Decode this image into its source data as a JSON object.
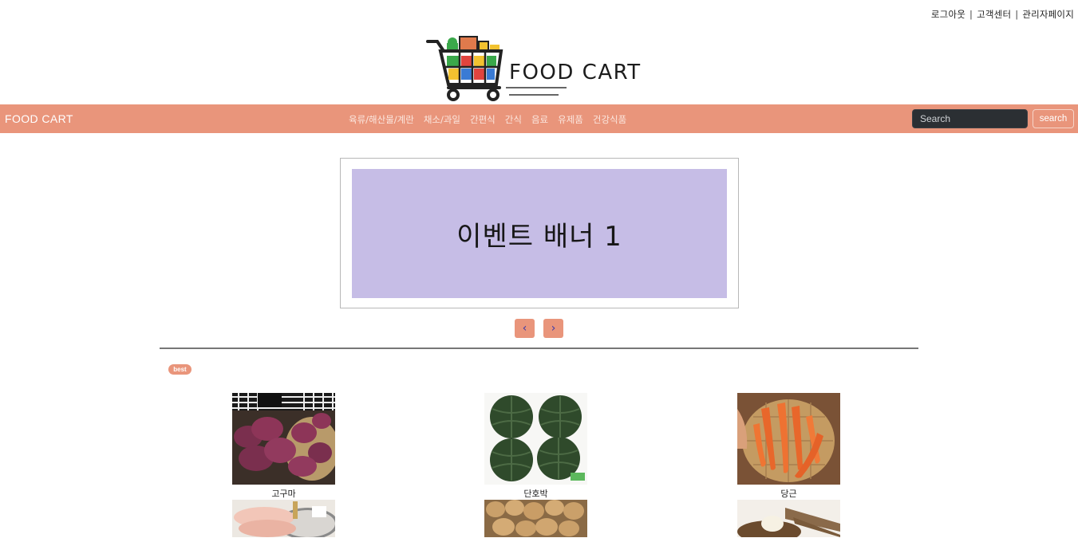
{
  "header": {
    "links": [
      {
        "label": "로그아웃"
      },
      {
        "label": "고객센터"
      },
      {
        "label": "관리자페이지"
      }
    ],
    "separator": "|",
    "logo_text": "FOOD CART"
  },
  "navbar": {
    "brand": "FOOD CART",
    "menu": [
      "육류/해산물/계란",
      "채소/과일",
      "간편식",
      "간식",
      "음료",
      "유제품",
      "건강식품"
    ],
    "search_placeholder": "Search",
    "search_button": "search",
    "background": "#e9957b"
  },
  "banner": {
    "text": "이벤트 배너 1",
    "background": "#c6bde6",
    "prev_label": "‹",
    "next_label": "›"
  },
  "section": {
    "badge": "best"
  },
  "products": [
    {
      "name": "고구마",
      "image": "sweet-potato-image"
    },
    {
      "name": "단호박",
      "image": "kabocha-image"
    },
    {
      "name": "당근",
      "image": "carrot-image"
    }
  ],
  "products_row2": [
    {
      "image": "chicken-breast-image"
    },
    {
      "image": "potato-image"
    },
    {
      "image": "yam-image"
    }
  ]
}
